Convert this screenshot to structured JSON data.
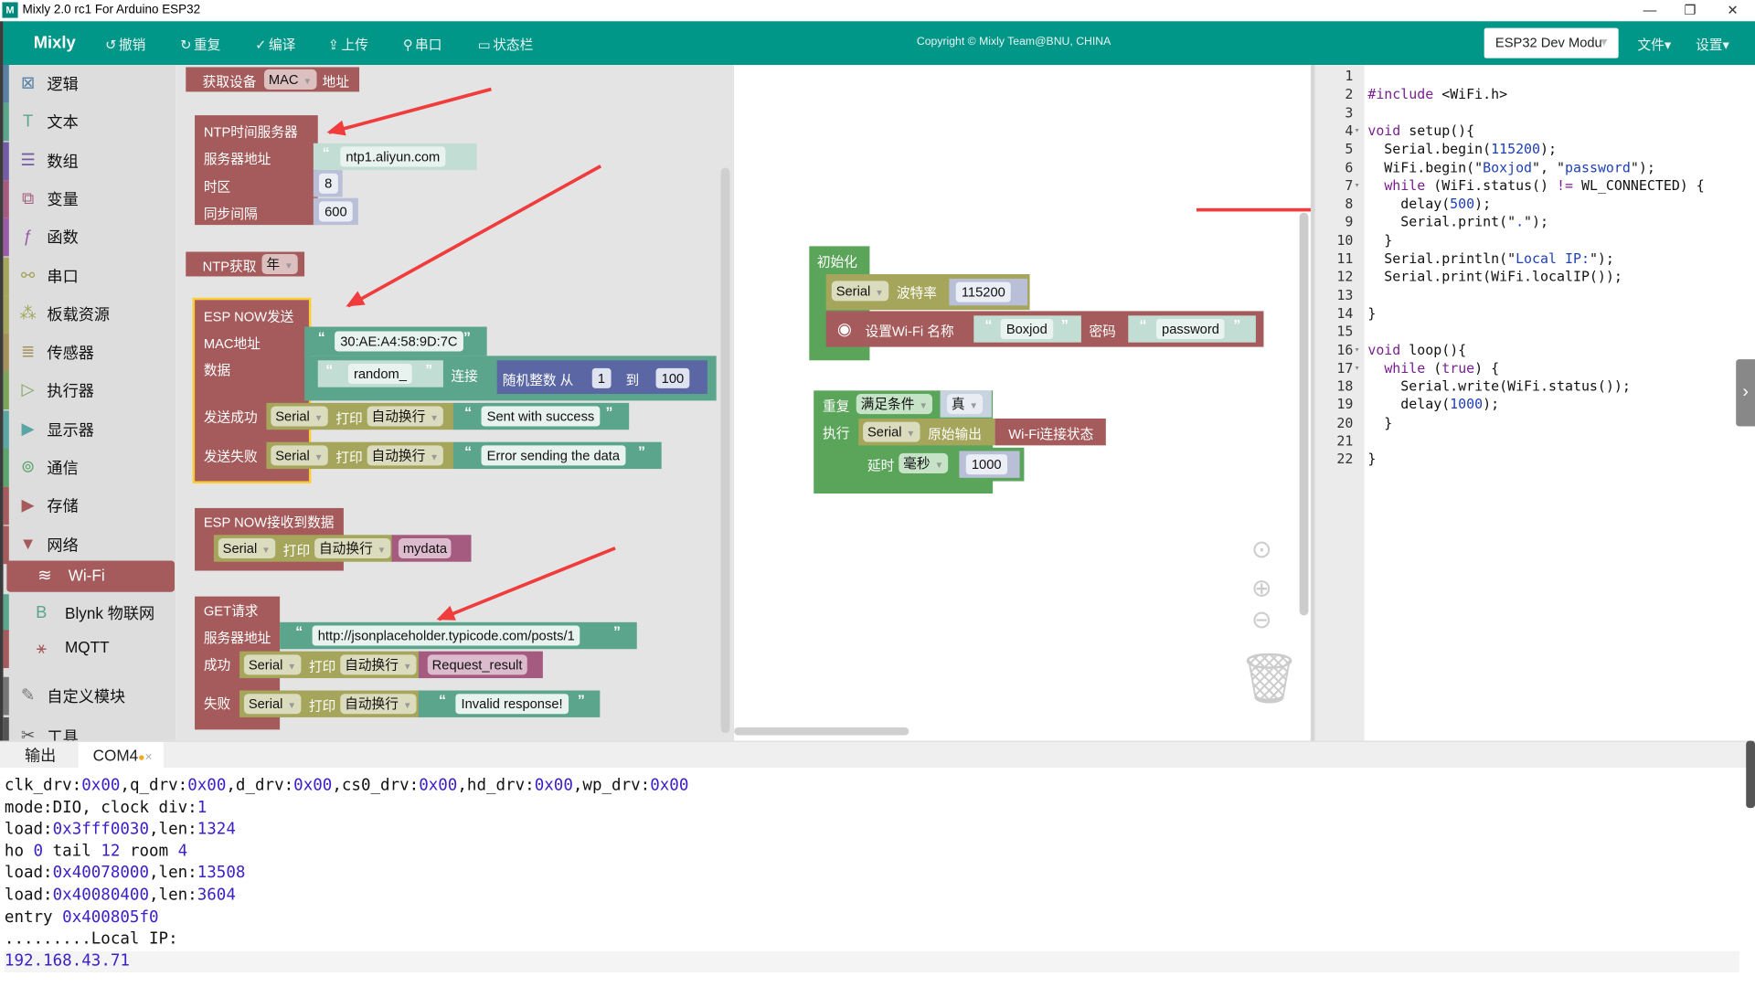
{
  "window": {
    "title": "Mixly 2.0 rc1 For Arduino ESP32",
    "app_icon": "mixly-logo",
    "minimize": "—",
    "restore": "❐",
    "close": "✕"
  },
  "toolbar": {
    "brand": "Mixly",
    "buttons": [
      {
        "icon": "undo-icon",
        "glyph": "↺",
        "label": "撤销"
      },
      {
        "icon": "redo-icon",
        "glyph": "↻",
        "label": "重复"
      },
      {
        "icon": "check-icon",
        "glyph": "✓",
        "label": "编译"
      },
      {
        "icon": "upload-icon",
        "glyph": "⇪",
        "label": "上传"
      },
      {
        "icon": "serial-icon",
        "glyph": "⚲",
        "label": "串口"
      },
      {
        "icon": "statusbar-icon",
        "glyph": "▭",
        "label": "状态栏"
      }
    ],
    "copyright": "Copyright © Mixly Team@BNU, CHINA",
    "board": "ESP32 Dev Modu",
    "file_menu": "文件▾",
    "settings_menu": "设置▾"
  },
  "sidebar": {
    "items": [
      {
        "label": "逻辑",
        "glyph": "⊠",
        "color": "#5b80a5"
      },
      {
        "label": "文本",
        "glyph": "T",
        "color": "#5ba58c"
      },
      {
        "label": "数组",
        "glyph": "☰",
        "color": "#745ba5"
      },
      {
        "label": "变量",
        "glyph": "⧉",
        "color": "#a55b80"
      },
      {
        "label": "函数",
        "glyph": "ƒ",
        "color": "#995ba5"
      },
      {
        "label": "串口",
        "glyph": "⚯",
        "color": "#a5a55b"
      },
      {
        "label": "板载资源",
        "glyph": "⁂",
        "color": "#a5a55b"
      },
      {
        "label": "传感器",
        "glyph": "≣",
        "color": "#a5915b"
      },
      {
        "label": "执行器",
        "glyph": "▷",
        "color": "#7ba55b"
      },
      {
        "label": "显示器",
        "glyph": "▶",
        "color": "#5ba5a5"
      },
      {
        "label": "通信",
        "glyph": "⊚",
        "color": "#5ba56c"
      },
      {
        "label": "存储",
        "glyph": "▶",
        "color": "#a55b5b"
      },
      {
        "label": "网络",
        "glyph": "▼",
        "color": "#a55b5b"
      }
    ],
    "selected": {
      "label": "Wi-Fi",
      "glyph": "≋"
    },
    "sub_items": [
      {
        "label": "Blynk 物联网",
        "glyph": "B",
        "color": "#5ba58c"
      },
      {
        "label": "MQTT",
        "glyph": "⚹",
        "color": "#a55b5b"
      }
    ],
    "custom": {
      "label": "自定义模块",
      "glyph": "✎"
    },
    "tools": {
      "label": "工具",
      "glyph": "✂"
    }
  },
  "flyout": {
    "mac_block": {
      "label1": "获取设备",
      "dropdown": "MAC",
      "label2": "地址"
    },
    "ntp_server": {
      "title": "NTP时间服务器",
      "server_label": "服务器地址",
      "server": "ntp1.aliyun.com",
      "tz_label": "时区",
      "tz": "8",
      "interval_label": "同步间隔",
      "interval": "600"
    },
    "ntp_get": {
      "label": "NTP获取",
      "dropdown": "年"
    },
    "espnow_send": {
      "title": "ESP NOW发送",
      "mac_label": "MAC地址",
      "mac": "30:AE:A4:58:9D:7C",
      "data_label": "数据",
      "data_str": "random_",
      "join": "连接",
      "rand_label": "随机整数 从",
      "rand_from": "1",
      "rand_to_label": "到",
      "rand_to": "100",
      "ok_label": "发送成功",
      "ok_msg": "Sent with success",
      "fail_label": "发送失败",
      "fail_msg": "Error sending the data"
    },
    "serial_print": {
      "port": "Serial",
      "print": "打印",
      "mode": "自动换行"
    },
    "espnow_recv": {
      "title": "ESP NOW接收到数据",
      "var": "mydata"
    },
    "get_req": {
      "title": "GET请求",
      "url_label": "服务器地址",
      "url": "http://jsonplaceholder.typicode.com/posts/1",
      "ok_label": "成功",
      "ok_var": "Request_result",
      "fail_label": "失败",
      "fail_msg": "Invalid response!"
    }
  },
  "workspace": {
    "setup": {
      "title": "初始化",
      "serial": "Serial",
      "baud_label": "波特率",
      "baud": "115200",
      "wifi_label": "设置Wi-Fi 名称",
      "ssid": "Boxjod",
      "pwd_label": "密码",
      "pwd": "password"
    },
    "loop": {
      "repeat": "重复",
      "cond": "满足条件",
      "bool": "真",
      "do": "执行",
      "serial": "Serial",
      "raw": "原始输出",
      "status": "Wi-Fi连接状态",
      "delay": "延时",
      "unit": "毫秒",
      "ms": "1000"
    }
  },
  "code": {
    "lines": [
      "",
      "#include <WiFi.h>",
      "",
      "void setup(){",
      "  Serial.begin(115200);",
      "  WiFi.begin(\"Boxjod\", \"password\");",
      "  while (WiFi.status() != WL_CONNECTED) {",
      "    delay(500);",
      "    Serial.print(\".\");",
      "  }",
      "  Serial.println(\"Local IP:\");",
      "  Serial.print(WiFi.localIP());",
      "",
      "}",
      "",
      "void loop(){",
      "  while (true) {",
      "    Serial.write(WiFi.status());",
      "    delay(1000);",
      "  }",
      "",
      "}"
    ]
  },
  "output": {
    "tabs": [
      {
        "label": "输出"
      },
      {
        "label": "COM4",
        "dot": "●",
        "close": "×"
      }
    ],
    "console": [
      "clk_drv:0x00,q_drv:0x00,d_drv:0x00,cs0_drv:0x00,hd_drv:0x00,wp_drv:0x00",
      "mode:DIO, clock div:1",
      "load:0x3fff0030,len:1324",
      "ho 0 tail 12 room 4",
      "load:0x40078000,len:13508",
      "load:0x40080400,len:3604",
      "entry 0x400805f0",
      ".........Local IP:",
      "192.168.43.71"
    ]
  }
}
